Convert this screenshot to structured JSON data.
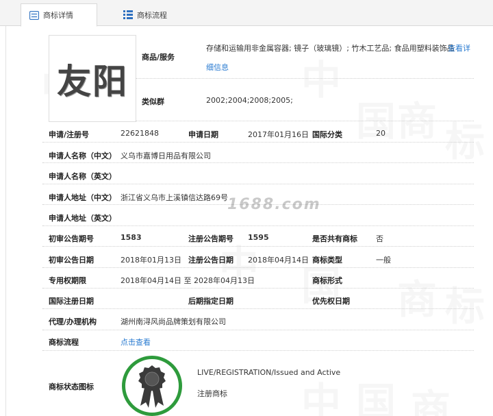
{
  "tabs": {
    "detail": "商标详情",
    "flow": "商标流程"
  },
  "logo_text": "友阳",
  "watermark_site": "1688.com",
  "goods": {
    "label": "商品/服务",
    "value": "存储和运输用非金属容器; 镜子（玻璃镜）; 竹木工艺品; 食品用塑料装饰品",
    "link_part1": "查看详",
    "link_part2": "细信息"
  },
  "similar": {
    "label": "类似群",
    "value": "2002;2004;2008;2005;"
  },
  "fields": {
    "reg_no_label": "申请/注册号",
    "reg_no": "22621848",
    "app_date_label": "申请日期",
    "app_date": "2017年01月16日",
    "intl_class_label": "国际分类",
    "intl_class": "20",
    "applicant_cn_label": "申请人名称（中文）",
    "applicant_cn": "义乌市嘉博日用品有限公司",
    "applicant_en_label": "申请人名称（英文）",
    "applicant_en": "",
    "address_cn_label": "申请人地址（中文）",
    "address_cn": "浙江省义乌市上溪镇信达路69号",
    "address_en_label": "申请人地址（英文）",
    "address_en": "",
    "prelim_no_label": "初审公告期号",
    "prelim_no": "1583",
    "reg_pub_no_label": "注册公告期号",
    "reg_pub_no": "1595",
    "shared_label": "是否共有商标",
    "shared": "否",
    "prelim_date_label": "初审公告日期",
    "prelim_date": "2018年01月13日",
    "reg_pub_date_label": "注册公告日期",
    "reg_pub_date": "2018年04月14日",
    "mark_type_label": "商标类型",
    "mark_type": "一般",
    "excl_period_label": "专用权期限",
    "excl_period": "2018年04月14日 至 2028年04月13日",
    "mark_form_label": "商标形式",
    "mark_form": "",
    "intl_reg_date_label": "国际注册日期",
    "intl_reg_date": "",
    "later_date_label": "后期指定日期",
    "later_date": "",
    "priority_date_label": "优先权日期",
    "priority_date": "",
    "agent_label": "代理/办理机构",
    "agent": "湖州南浔风尚品牌策划有限公司",
    "flow_label": "商标流程",
    "flow_link": "点击查看",
    "status_label": "商标状态图标",
    "status_en": "LIVE/REGISTRATION/Issued and Active",
    "status_cn": "注册商标"
  },
  "colors": {
    "accent_link": "#2a7bd1",
    "badge_green": "#2e9b3c",
    "badge_dark": "#3a3a3a"
  }
}
